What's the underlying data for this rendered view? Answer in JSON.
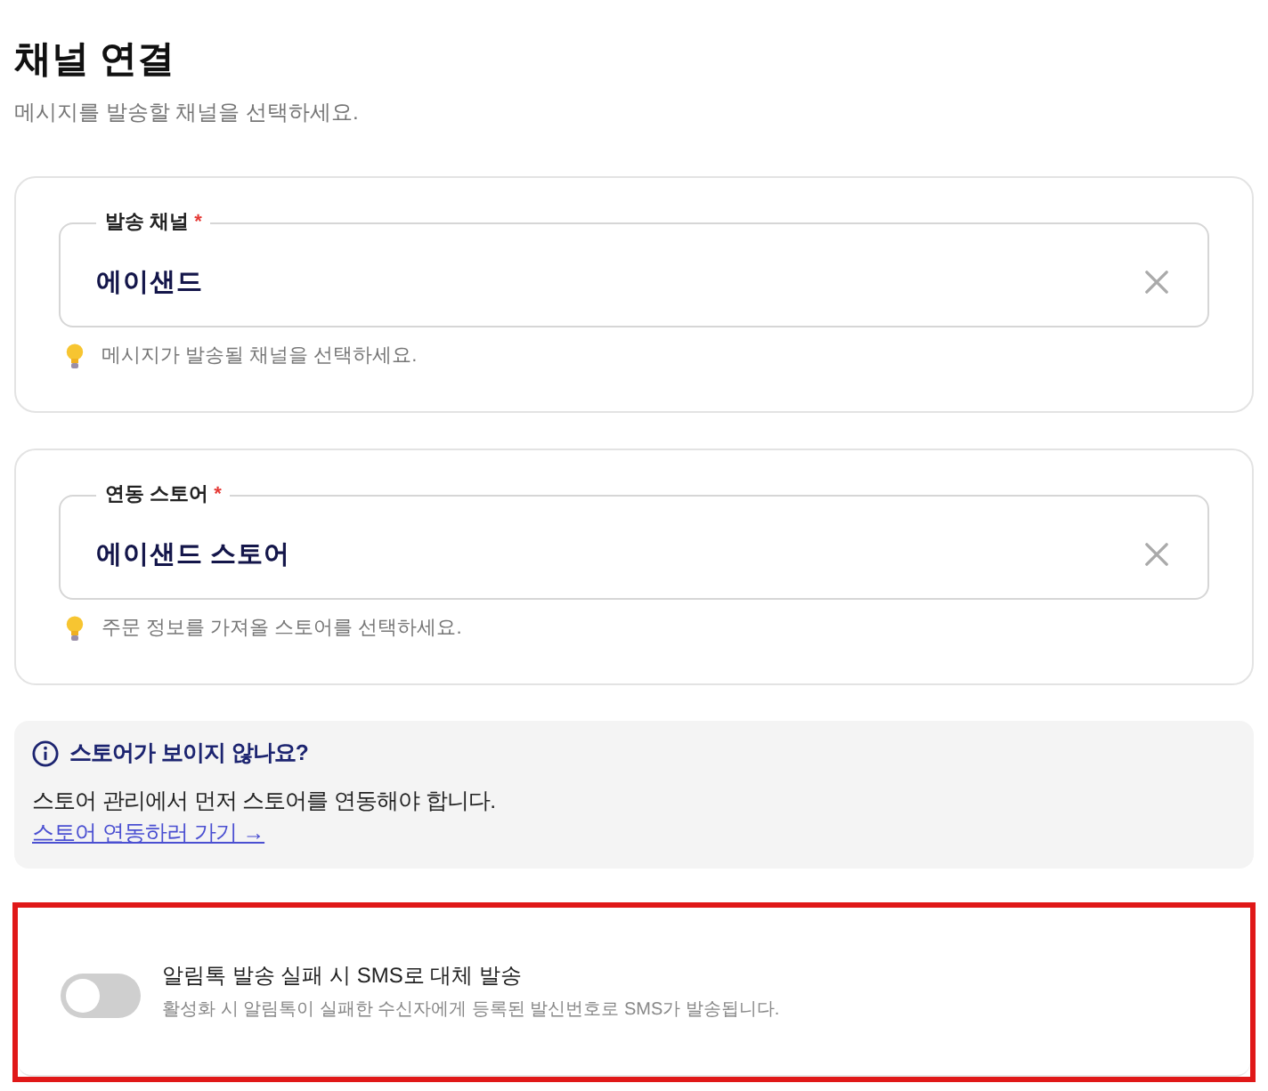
{
  "page": {
    "title": "채널 연결",
    "subtitle": "메시지를 발송할 채널을 선택하세요."
  },
  "fields": [
    {
      "label": "발송 채널",
      "required_mark": "*",
      "value": "에이샌드",
      "hint": "메시지가 발송될 채널을 선택하세요."
    },
    {
      "label": "연동 스토어",
      "required_mark": "*",
      "value": "에이샌드 스토어",
      "hint": "주문 정보를 가져올 스토어를 선택하세요."
    }
  ],
  "notice": {
    "title": "스토어가 보이지 않나요?",
    "text": "스토어 관리에서 먼저 스토어를 연동해야 합니다.",
    "link": "스토어 연동하러 가기 →"
  },
  "fallback": {
    "label": "알림톡 발송 실패 시 SMS로 대체 발송",
    "description": "활성화 시 알림톡이 실패한 수신자에게 등록된 발신번호로 SMS가 발송됩니다.",
    "on": false,
    "highlighted": true
  }
}
